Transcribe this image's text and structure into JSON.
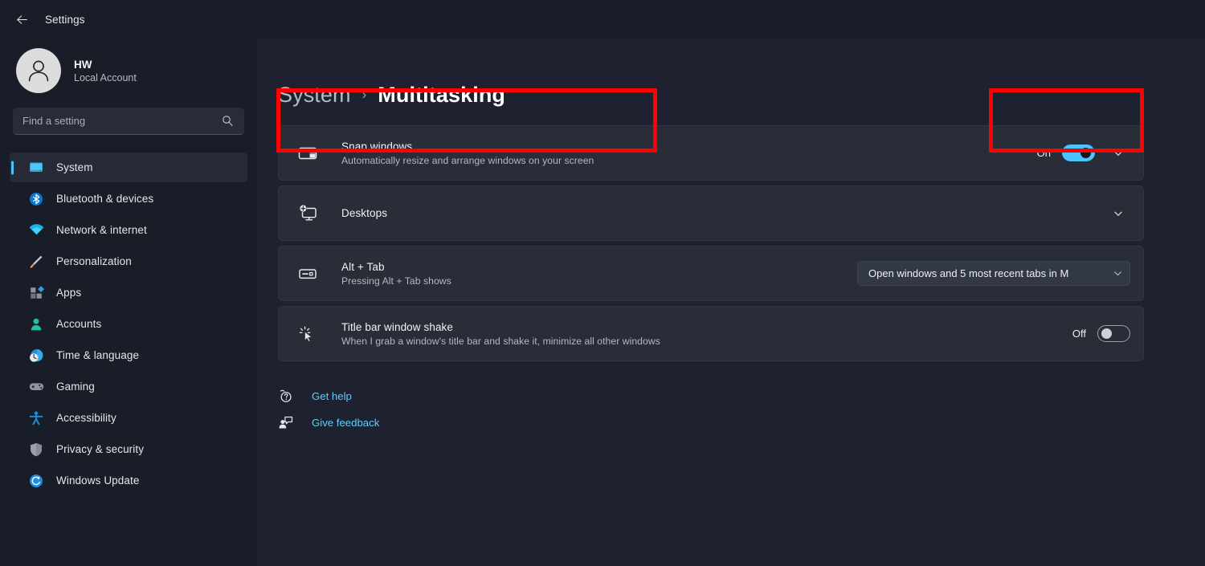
{
  "titlebar": {
    "back_icon": "arrow-left-icon",
    "title": "Settings"
  },
  "sidebar": {
    "account": {
      "avatar_icon": "user-avatar-icon",
      "name": "HW",
      "subtitle": "Local Account"
    },
    "search": {
      "placeholder": "Find a setting",
      "value": "",
      "icon": "search-icon"
    },
    "items": [
      {
        "label": "System",
        "icon": "monitor-icon",
        "active": true
      },
      {
        "label": "Bluetooth & devices",
        "icon": "bluetooth-icon",
        "active": false
      },
      {
        "label": "Network & internet",
        "icon": "wifi-icon",
        "active": false
      },
      {
        "label": "Personalization",
        "icon": "paintbrush-icon",
        "active": false
      },
      {
        "label": "Apps",
        "icon": "apps-grid-icon",
        "active": false
      },
      {
        "label": "Accounts",
        "icon": "person-icon",
        "active": false
      },
      {
        "label": "Time & language",
        "icon": "clock-globe-icon",
        "active": false
      },
      {
        "label": "Gaming",
        "icon": "gamepad-icon",
        "active": false
      },
      {
        "label": "Accessibility",
        "icon": "accessibility-person-icon",
        "active": false
      },
      {
        "label": "Privacy & security",
        "icon": "shield-icon",
        "active": false
      },
      {
        "label": "Windows Update",
        "icon": "refresh-circle-icon",
        "active": false
      }
    ]
  },
  "breadcrumb": {
    "parent": "System",
    "separator": "›",
    "current": "Multitasking"
  },
  "settings_rows": [
    {
      "title": "Snap windows",
      "subtitle": "Automatically resize and arrange windows on your screen",
      "icon": "snap-layout-icon",
      "control": "toggle",
      "state_label": "On",
      "toggle_on": true,
      "has_expander": true
    },
    {
      "title": "Desktops",
      "subtitle": "",
      "icon": "desktop-add-icon",
      "control": "expander",
      "state_label": "",
      "has_expander": true
    },
    {
      "title": "Alt + Tab",
      "subtitle": "Pressing Alt + Tab shows",
      "icon": "alt-tab-keyboard-icon",
      "control": "dropdown",
      "dropdown_value": "Open windows and 5 most recent tabs in M",
      "has_expander": false
    },
    {
      "title": "Title bar window shake",
      "subtitle": "When I grab a window's title bar and shake it, minimize all other windows",
      "icon": "cursor-shake-icon",
      "control": "toggle",
      "state_label": "Off",
      "toggle_on": false,
      "has_expander": false
    }
  ],
  "footer_links": [
    {
      "label": "Get help",
      "icon": "help-question-icon"
    },
    {
      "label": "Give feedback",
      "icon": "feedback-person-icon"
    }
  ],
  "colors": {
    "accent": "#4cc2ff",
    "link": "#60cdff",
    "page_bg": "#1e2230",
    "sidebar_bg": "#191d28",
    "card_bg": "#282d37",
    "highlight_box": "#ff0000",
    "toggle_on_bg": "#4cc2ff"
  },
  "annotations": [
    {
      "name": "snap-windows-row-highlight",
      "color": "#ff0000"
    },
    {
      "name": "snap-windows-toggle-highlight",
      "color": "#ff0000"
    }
  ]
}
